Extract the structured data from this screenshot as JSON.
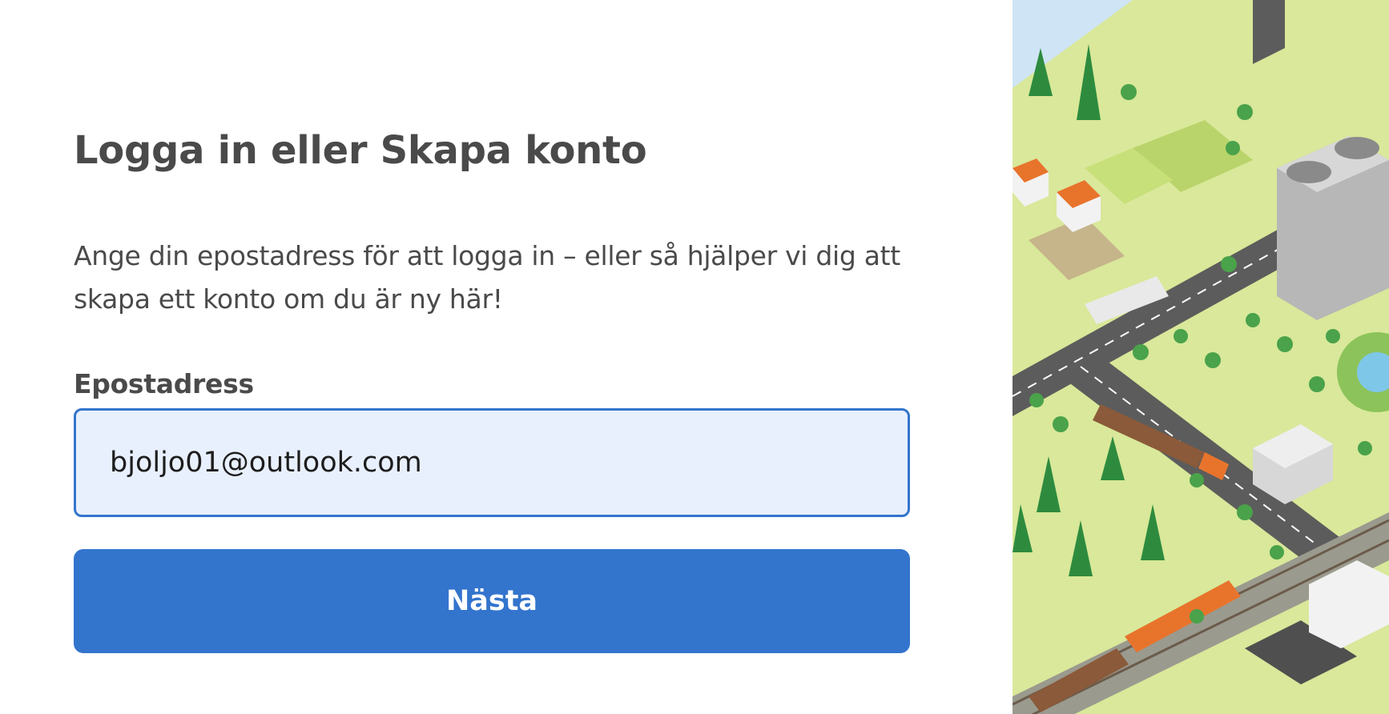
{
  "login": {
    "title": "Logga in eller Skapa konto",
    "subtitle": "Ange din epostadress för att logga in – eller så hjälper vi dig att skapa ett konto om du är ny här!",
    "email_label": "Epostadress",
    "email_value": "bjoljo01@outlook.com",
    "next_button_label": "Nästa"
  },
  "colors": {
    "accent": "#3374cd",
    "input_background": "#e8f0fe",
    "text": "#4a4a4a",
    "grass": "#d9e89a",
    "road": "#5c5c5c",
    "tree": "#2e8b3e",
    "truck_orange": "#e8742c",
    "water": "#cfe4f5"
  },
  "icons": {
    "illustration": "isometric-town-illustration"
  }
}
